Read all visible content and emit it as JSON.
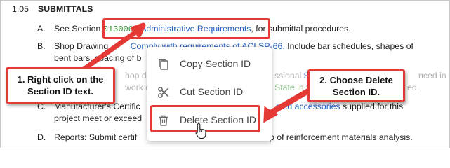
{
  "section": {
    "number": "1.05",
    "title": "SUBMITTALS"
  },
  "items": [
    {
      "letter": "A.",
      "prefix": "See Section ",
      "section_id": "013000",
      "dash": " - ",
      "link": "Administrative Requirements",
      "suffix": ", for submittal procedures."
    },
    {
      "letter": "B.",
      "line1_start": "Shop Drawing",
      "line1_link": "Comply with requirements of ACI SP-66.",
      "line1_end": "Include bar schedules, shapes of",
      "line2": "bent bars, spacing of b",
      "line3_a": "hop dra",
      "line3_b": "ssional",
      "line3_link": "Str",
      "line3_c": "nced in",
      "line4_a": "work of",
      "line4_green": "State in w",
      "line4_b": "ed."
    },
    {
      "letter": "C.",
      "line1_a": "Manufacturer's Certific",
      "line1_link": "sted accessories",
      "line1_b": "supplied for this",
      "line2": "project meet or exceed"
    },
    {
      "letter": "D.",
      "text_a": "Reports:  Submit certif",
      "text_b": "p of reinforcement materials analysis."
    }
  ],
  "context_menu": {
    "items": [
      {
        "label": "Copy Section ID",
        "icon": "copy-icon"
      },
      {
        "label": "Cut Section ID",
        "icon": "scissors-icon"
      },
      {
        "label": "Delete Section ID",
        "icon": "trash-icon"
      }
    ],
    "highlighted": "Delete Section ID"
  },
  "callouts": {
    "step1": "1. Right click on the Section ID text.",
    "step2": "2. Choose Delete Section ID."
  },
  "colors": {
    "accent_red": "#e53935",
    "link_blue": "#1f5fbf",
    "section_id_green": "#2e8b2e"
  }
}
